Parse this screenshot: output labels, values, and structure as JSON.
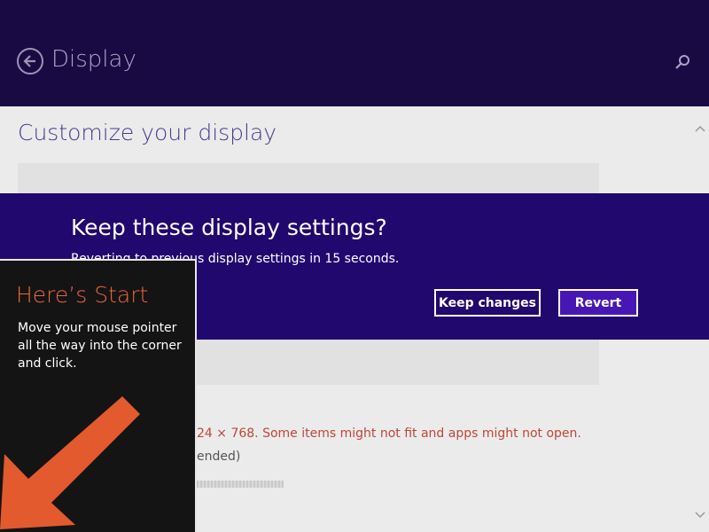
{
  "header": {
    "title": "Display",
    "back_icon": "back-arrow-circle-icon",
    "search_icon": "search-icon"
  },
  "content": {
    "section_title": "Customize your display",
    "warning_text": "24 × 768. Some items might not fit and apps might not open.",
    "recommended_text": "ended)"
  },
  "dialog": {
    "title": "Keep these display settings?",
    "subtitle": "Reverting to previous display settings in 15 seconds.",
    "keep_label": "Keep changes",
    "revert_label": "Revert"
  },
  "tip": {
    "title": "Here’s Start",
    "body": "Move your mouse pointer all the way into the corner and click.",
    "arrow_icon": "corner-arrow-icon"
  },
  "colors": {
    "header_bg": "#1a0a44",
    "dialog_bg": "#21086e",
    "revert_bg": "#4617b4",
    "tip_accent": "#e8663c",
    "warning": "#c0463a"
  }
}
